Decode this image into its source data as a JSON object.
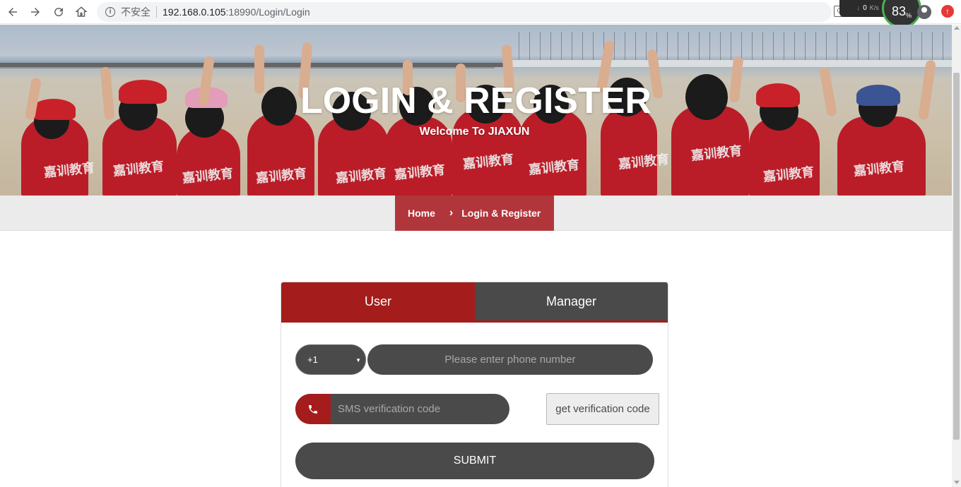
{
  "browser": {
    "security_label": "不安全",
    "url_host": "192.168.0.105",
    "url_path": ":18990/Login/Login",
    "speed_value": "0",
    "speed_unit": "K/s",
    "gauge_value": "83",
    "gauge_unit": "%"
  },
  "banner": {
    "title": "LOGIN & REGISTER",
    "subtitle": "Welcome To JIAXUN",
    "shirt_text": "嘉训教育"
  },
  "breadcrumb": {
    "home": "Home",
    "separator": "›",
    "current": "Login & Register"
  },
  "login": {
    "tabs": [
      {
        "label": "User",
        "active": true
      },
      {
        "label": "Manager",
        "active": false
      }
    ],
    "country_code": "+1",
    "phone_placeholder": "Please enter phone number",
    "sms_placeholder": "SMS verification code",
    "get_code_label": "get verification code",
    "submit_label": "SUBMIT"
  },
  "colors": {
    "brand_red": "#a51c1c",
    "breadcrumb_red": "#b1363c",
    "dark_gray": "#4a4a4a"
  }
}
